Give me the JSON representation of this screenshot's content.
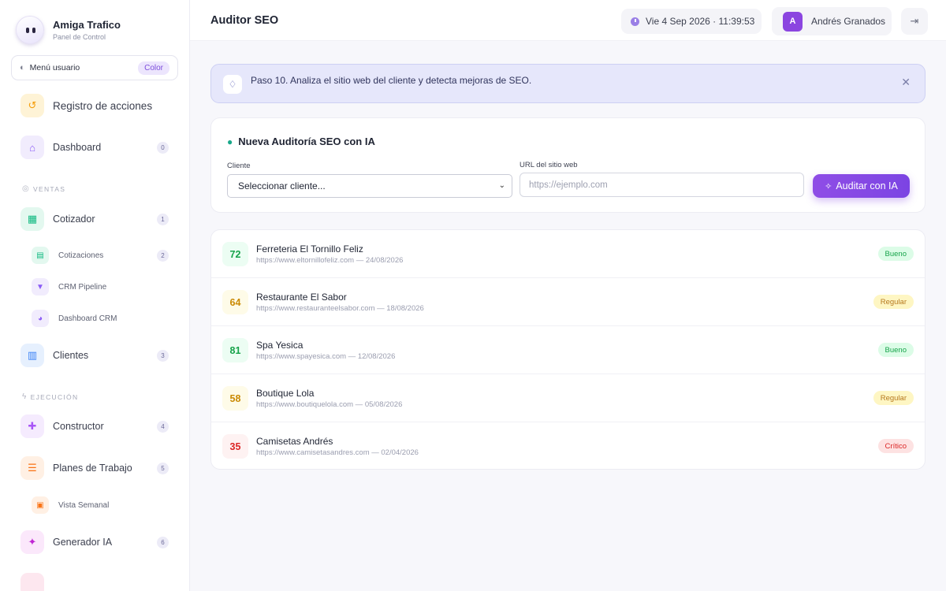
{
  "brand": {
    "name": "Amiga Trafico",
    "subtitle": "Panel de Control"
  },
  "user_menu": {
    "label": "Menú usuario",
    "badge": "Color",
    "icon": "palette-icon"
  },
  "sidebar": {
    "items": [
      {
        "label": "Registro de acciones",
        "icon": "history-icon",
        "color": "#f59e0b"
      },
      {
        "label": "Dashboard",
        "icon": "home-icon",
        "count": "0",
        "color": "#8b5cf6"
      },
      {
        "label": "Cotizador",
        "icon": "calculator-icon",
        "count": "1",
        "color": "#10b981"
      },
      {
        "label": "Clientes",
        "icon": "building-icon",
        "count": "3",
        "color": "#3b82f6"
      },
      {
        "label": "Constructor",
        "icon": "puzzle-icon",
        "count": "4",
        "color": "#a855f7"
      },
      {
        "label": "Planes de Trabajo",
        "icon": "checklist-icon",
        "count": "5",
        "color": "#f97316"
      },
      {
        "label": "Generador IA",
        "icon": "magic-wand-icon",
        "count": "6",
        "color": "#c026d3"
      }
    ],
    "sub_items": [
      {
        "label": "Cotizaciones",
        "icon": "document-icon",
        "count": "2",
        "color": "#10b981"
      },
      {
        "label": "CRM Pipeline",
        "icon": "filter-icon",
        "color": "#8b5cf6"
      },
      {
        "label": "Dashboard CRM",
        "icon": "pie-chart-icon",
        "color": "#8b5cf6"
      },
      {
        "label": "Vista Semanal",
        "icon": "calendar-icon",
        "color": "#f97316"
      }
    ],
    "sections": {
      "ventas": "VENTAS",
      "ejecucion": "EJECUCIÓN"
    }
  },
  "topbar": {
    "title": "Auditor SEO",
    "datetime": "Vie 4 Sep 2026 · 11:39:53",
    "user_initial": "A",
    "user_name": "Andrés Granados"
  },
  "alert": {
    "text": "Paso 10. Analiza el sitio web del cliente y detecta mejoras de SEO."
  },
  "form": {
    "title": "Nueva Auditoría SEO con IA",
    "client_label": "Cliente",
    "client_value": "Seleccionar cliente...",
    "url_label": "URL del sitio web",
    "url_placeholder": "https://ejemplo.com",
    "submit_label": "Auditar con IA"
  },
  "audits": [
    {
      "score": "72",
      "name": "Ferreteria El Tornillo Feliz",
      "meta": "https://www.eltornillofeliz.com — 24/08/2026",
      "status": "Bueno"
    },
    {
      "score": "64",
      "name": "Restaurante El Sabor",
      "meta": "https://www.restauranteelsabor.com — 18/08/2026",
      "status": "Regular"
    },
    {
      "score": "81",
      "name": "Spa Yesica",
      "meta": "https://www.spayesica.com — 12/08/2026",
      "status": "Bueno"
    },
    {
      "score": "58",
      "name": "Boutique Lola",
      "meta": "https://www.boutiquelola.com — 05/08/2026",
      "status": "Regular"
    },
    {
      "score": "35",
      "name": "Camisetas Andrés",
      "meta": "https://www.camisetasandres.com — 02/04/2026",
      "status": "Crítico"
    }
  ],
  "status_colors": {
    "Bueno": {
      "bg": "#dcfce7",
      "fg": "#16a34a",
      "score_bg": "#ecfdf3",
      "score_fg": "#16a34a"
    },
    "Regular": {
      "bg": "#fef6c3",
      "fg": "#b7791f",
      "score_bg": "#fefbe8",
      "score_fg": "#ca8a04"
    },
    "Crítico": {
      "bg": "#fde2e2",
      "fg": "#dc2626",
      "score_bg": "#fef2f2",
      "score_fg": "#dc2626"
    }
  }
}
